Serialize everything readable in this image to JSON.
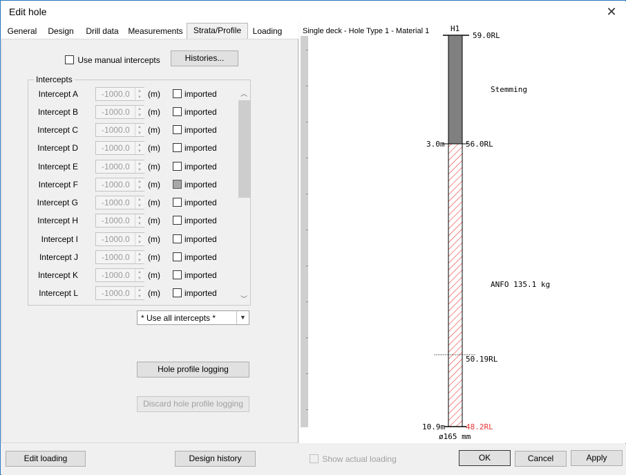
{
  "window": {
    "title": "Edit hole"
  },
  "tabs": [
    "General",
    "Design",
    "Drill data",
    "Measurements",
    "Strata/Profile",
    "Loading"
  ],
  "strata": {
    "manual_intercepts_label": "Use manual intercepts",
    "histories_label": "Histories...",
    "group_title": "Intercepts",
    "intercepts": [
      {
        "label": "Intercept A",
        "value": "-1000.0",
        "unit": "(m)",
        "imported_label": "imported",
        "imported_checked": false
      },
      {
        "label": "Intercept B",
        "value": "-1000.0",
        "unit": "(m)",
        "imported_label": "imported",
        "imported_checked": false
      },
      {
        "label": "Intercept C",
        "value": "-1000.0",
        "unit": "(m)",
        "imported_label": "imported",
        "imported_checked": false
      },
      {
        "label": "Intercept D",
        "value": "-1000.0",
        "unit": "(m)",
        "imported_label": "imported",
        "imported_checked": false
      },
      {
        "label": "Intercept E",
        "value": "-1000.0",
        "unit": "(m)",
        "imported_label": "imported",
        "imported_checked": false
      },
      {
        "label": "Intercept F",
        "value": "-1000.0",
        "unit": "(m)",
        "imported_label": "imported",
        "imported_checked": true
      },
      {
        "label": "Intercept G",
        "value": "-1000.0",
        "unit": "(m)",
        "imported_label": "imported",
        "imported_checked": false
      },
      {
        "label": "Intercept H",
        "value": "-1000.0",
        "unit": "(m)",
        "imported_label": "imported",
        "imported_checked": false
      },
      {
        "label": "Intercept I",
        "value": "-1000.0",
        "unit": "(m)",
        "imported_label": "imported",
        "imported_checked": false
      },
      {
        "label": "Intercept J",
        "value": "-1000.0",
        "unit": "(m)",
        "imported_label": "imported",
        "imported_checked": false
      },
      {
        "label": "Intercept K",
        "value": "-1000.0",
        "unit": "(m)",
        "imported_label": "imported",
        "imported_checked": false
      },
      {
        "label": "Intercept L",
        "value": "-1000.0",
        "unit": "(m)",
        "imported_label": "imported",
        "imported_checked": false
      }
    ],
    "intercept_select": "* Use all intercepts *",
    "hole_profile_logging_label": "Hole profile logging",
    "discard_logging_label": "Discard hole profile logging"
  },
  "profile": {
    "heading": "Single deck - Hole Type 1 - Material 1",
    "hole_id": "H1",
    "collar_rl": "59.0RL",
    "stemming_label": "Stemming",
    "stemming_depth": "3.0m",
    "stemming_base_rl": "56.0RL",
    "explosive_label": "ANFO 135.1 kg",
    "marker_rl": "50.19RL",
    "total_depth": "10.9m",
    "toe_rl": "48.2RL",
    "diameter": "ø165 mm",
    "colors": {
      "stemming": "#808080",
      "explosive_hatch": "#e53935",
      "toe_rl": "#e53935"
    }
  },
  "footer": {
    "edit_loading_label": "Edit loading",
    "design_history_label": "Design history",
    "show_actual_loading_label": "Show actual loading",
    "ok_label": "OK",
    "cancel_label": "Cancel",
    "apply_label": "Apply"
  }
}
